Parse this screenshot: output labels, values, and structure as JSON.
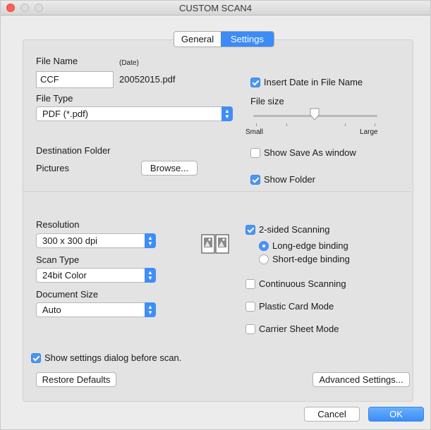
{
  "window": {
    "title": "CUSTOM SCAN4"
  },
  "tabs": [
    {
      "label": "General"
    },
    {
      "label": "Settings"
    }
  ],
  "file_name": {
    "label": "File Name",
    "date_label": "(Date)",
    "value": "CCF",
    "suffix": "20052015.pdf"
  },
  "file_type": {
    "label": "File Type",
    "selected": "PDF (*.pdf)"
  },
  "insert_date": {
    "label": "Insert Date in File Name",
    "checked": true
  },
  "file_size": {
    "label": "File size",
    "min_label": "Small",
    "max_label": "Large",
    "level": 0.5
  },
  "destination": {
    "label": "Destination Folder",
    "folder": "Pictures",
    "browse_label": "Browse..."
  },
  "show_save_as": {
    "label": "Show Save As window",
    "checked": false
  },
  "show_folder": {
    "label": "Show Folder",
    "checked": true
  },
  "resolution": {
    "label": "Resolution",
    "selected": "300 x 300 dpi"
  },
  "scan_type": {
    "label": "Scan Type",
    "selected": "24bit Color"
  },
  "document_size": {
    "label": "Document Size",
    "selected": "Auto"
  },
  "two_sided": {
    "label": "2-sided Scanning",
    "checked": true
  },
  "binding": {
    "long_label": "Long-edge binding",
    "short_label": "Short-edge binding",
    "selected": "long"
  },
  "continuous": {
    "label": "Continuous Scanning",
    "checked": false
  },
  "plastic_card": {
    "label": "Plastic Card Mode",
    "checked": false
  },
  "carrier_sheet": {
    "label": "Carrier Sheet Mode",
    "checked": false
  },
  "show_settings_dialog": {
    "label": "Show settings dialog before scan.",
    "checked": true
  },
  "buttons": {
    "restore": "Restore Defaults",
    "advanced": "Advanced Settings...",
    "cancel": "Cancel",
    "ok": "OK"
  },
  "colors": {
    "accent": "#3c8bf7",
    "close": "#fc5f57"
  }
}
